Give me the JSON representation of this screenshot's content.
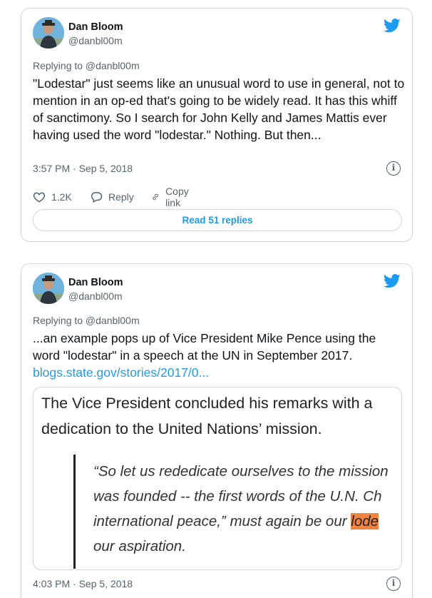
{
  "colors": {
    "link": "#1d9bf0",
    "muted": "#536471",
    "border": "#cfd9de",
    "highlight": "#f5813f"
  },
  "tweets": [
    {
      "author_name": "Dan Bloom",
      "author_handle": "@danbl00m",
      "replying_to": "Replying to @danbl00m",
      "text": "\"Lodestar\" just seems like an unusual word to use in general, not to mention in an op-ed that's going to be widely read. It has this whiff of sanctimony. So I search for John Kelly and James Mattis ever having used the word \"lodestar.\" Nothing. But then...",
      "timestamp": "3:57 PM · Sep 5, 2018",
      "like_count": "1.2K",
      "reply_label": "Reply",
      "copy_link_label": "Copy link",
      "read_replies_label": "Read 51 replies",
      "icons": [
        "twitter-bird-icon",
        "info-icon",
        "heart-icon",
        "reply-icon",
        "link-icon"
      ]
    },
    {
      "author_name": "Dan Bloom",
      "author_handle": "@danbl00m",
      "replying_to": "Replying to @danbl00m",
      "text": "...an example pops up of Vice President Mike Pence using the word \"lodestar\" in a speech at the UN in September 2017.",
      "link_text": "blogs.state.gov/stories/2017/0...",
      "embed": {
        "line1": "The Vice President concluded his remarks with a",
        "line2": "dedication to the United Nations’ mission.",
        "quote1": "“So let us rededicate ourselves to the mission",
        "quote2": "was founded -- the first words of the U.N. Ch",
        "quote3_before": "international peace,” must again be our ",
        "quote3_highlight": "lode",
        "quote4": "our aspiration."
      },
      "timestamp": "4:03 PM · Sep 5, 2018",
      "icons": [
        "twitter-bird-icon",
        "info-icon"
      ]
    }
  ]
}
